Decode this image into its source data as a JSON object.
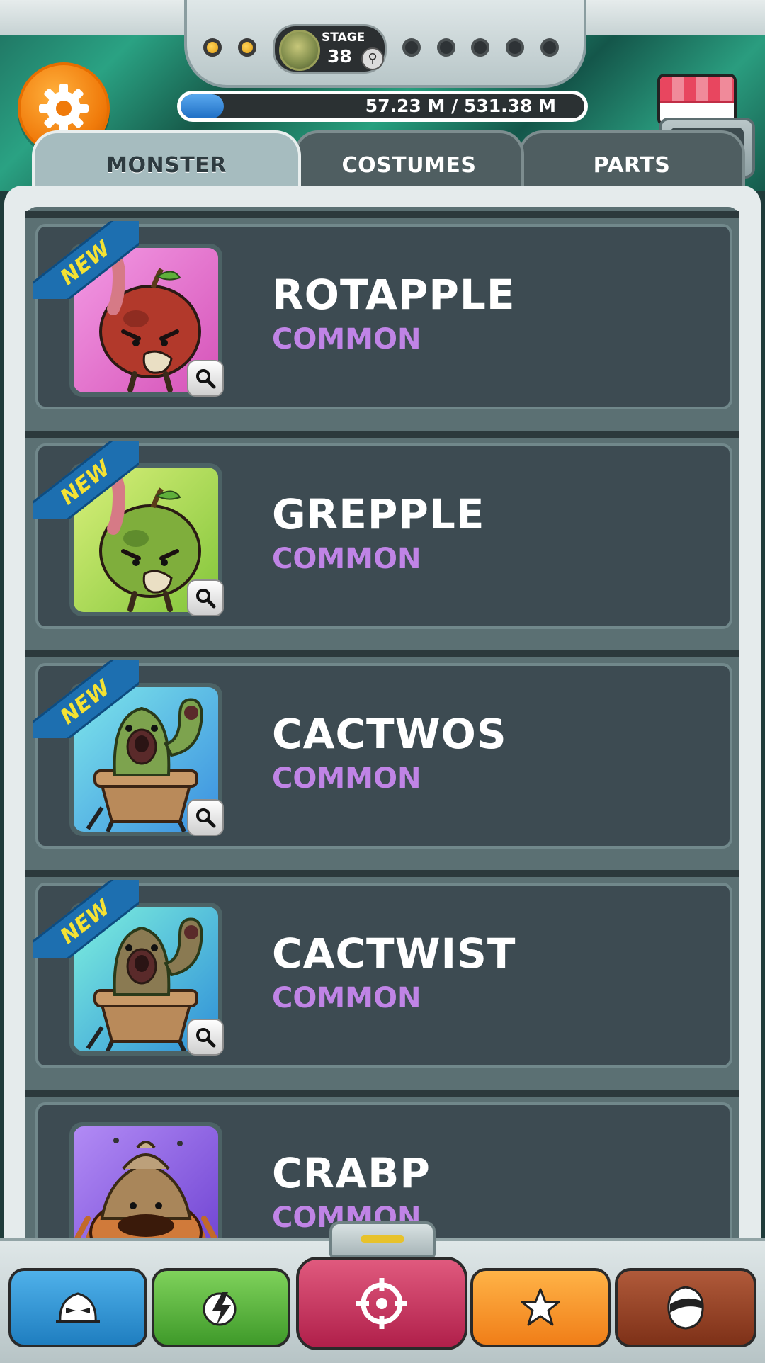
{
  "hud": {
    "stage_label": "STAGE",
    "stage_number": "38",
    "stage_dots": [
      {
        "status": "done"
      },
      {
        "status": "done"
      },
      {
        "status": "todo"
      },
      {
        "status": "todo"
      },
      {
        "status": "todo"
      },
      {
        "status": "todo"
      },
      {
        "status": "todo"
      }
    ],
    "progress_text": "57.23 M / 531.38 M",
    "progress_fraction": 0.1077,
    "settings_icon": "gear-icon",
    "shop_icon": "shop-awning-icon",
    "expand_icon": "chevron-down-icon"
  },
  "tabs": [
    {
      "label": "MONSTER",
      "active": true
    },
    {
      "label": "COSTUMES",
      "active": false
    },
    {
      "label": "PARTS",
      "active": false
    }
  ],
  "monsters": [
    {
      "name": "ROTAPPLE",
      "rarity": "COMMON",
      "badge": "NEW",
      "bg": [
        "#f39ae4",
        "#d553b8"
      ],
      "kind": "apple-red"
    },
    {
      "name": "GREPPLE",
      "rarity": "COMMON",
      "badge": "NEW",
      "bg": [
        "#d9f07a",
        "#82c53a"
      ],
      "kind": "apple-green"
    },
    {
      "name": "CACTWOS",
      "rarity": "COMMON",
      "badge": "NEW",
      "bg": [
        "#7ee6ea",
        "#3a8fe0"
      ],
      "kind": "cactus-green"
    },
    {
      "name": "CACTWIST",
      "rarity": "COMMON",
      "badge": "NEW",
      "bg": [
        "#7ef0de",
        "#2f8fd8"
      ],
      "kind": "cactus-brown"
    },
    {
      "name": "CRABP",
      "rarity": "COMMON",
      "badge": "",
      "bg": [
        "#b28bf5",
        "#6b3fd0"
      ],
      "kind": "crab"
    }
  ],
  "colors": {
    "rarity_common": "#c084e6",
    "new_badge_text": "#f5e233",
    "new_badge_band": "#1d6fb0"
  },
  "bottom_nav": [
    {
      "name": "monster-nav",
      "icon": "monster-face-icon",
      "color": "#2f95d6"
    },
    {
      "name": "skill-nav",
      "icon": "lightning-fist-icon",
      "color": "#5cb33d"
    },
    {
      "name": "battle-nav",
      "icon": "crosshair-icon",
      "color": "#c83060"
    },
    {
      "name": "achievements-nav",
      "icon": "star-icon",
      "color": "#f59a2a"
    },
    {
      "name": "profile-nav",
      "icon": "hero-mask-icon",
      "color": "#9a4528"
    }
  ]
}
